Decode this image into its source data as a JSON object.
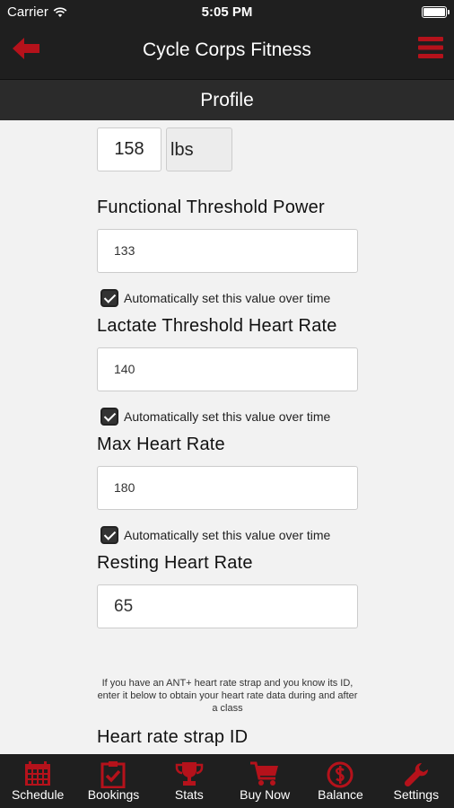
{
  "status_bar": {
    "carrier": "Carrier",
    "time": "5:05 PM"
  },
  "nav": {
    "title": "Cycle Corps Fitness"
  },
  "subnav": {
    "title": "Profile"
  },
  "weight": {
    "value": "158",
    "unit": "lbs"
  },
  "ftp": {
    "label": "Functional Threshold Power",
    "value": "133",
    "auto_label": "Automatically set this value over time"
  },
  "lthr": {
    "label": "Lactate Threshold Heart Rate",
    "value": "140",
    "auto_label": "Automatically set this value over time"
  },
  "max_hr": {
    "label": "Max Heart Rate",
    "value": "180",
    "auto_label": "Automatically set this value over time"
  },
  "resting_hr": {
    "label": "Resting Heart Rate",
    "value": "65"
  },
  "strap": {
    "info": "If you have an ANT+ heart rate strap and you know its ID, enter it below to obtain your heart rate data during and after a class",
    "label": "Heart rate strap ID"
  },
  "tabs": [
    {
      "label": "Schedule",
      "icon": "calendar-icon"
    },
    {
      "label": "Bookings",
      "icon": "clipboard-check-icon"
    },
    {
      "label": "Stats",
      "icon": "trophy-icon"
    },
    {
      "label": "Buy Now",
      "icon": "cart-icon"
    },
    {
      "label": "Balance",
      "icon": "dollar-icon"
    },
    {
      "label": "Settings",
      "icon": "wrench-icon"
    }
  ],
  "colors": {
    "accent": "#b5121b",
    "bar": "#1f1f1f",
    "background": "#f2f2f2"
  }
}
